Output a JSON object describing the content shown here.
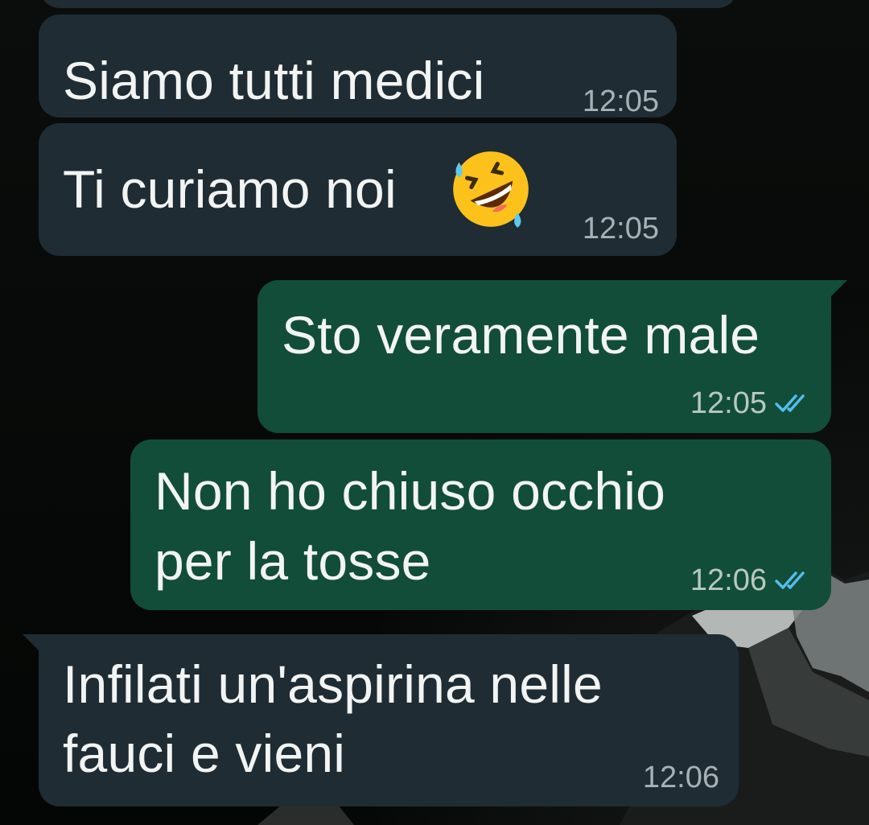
{
  "messages": [
    {
      "text": "Siamo tutti medici",
      "time": "12:05"
    },
    {
      "text": "Ti curiamo noi",
      "emoji_name": "rolling-on-the-floor-laughing-emoji",
      "time": "12:05"
    },
    {
      "text": "Sto veramente male",
      "time": "12:05",
      "status": "read"
    },
    {
      "text": [
        "Non ho chiuso occhio",
        "per la tosse"
      ],
      "time": "12:06",
      "status": "read"
    },
    {
      "text": [
        "Infilati un'aspirina nelle",
        "fauci e vieni"
      ],
      "time": "12:06"
    }
  ],
  "colors": {
    "incoming_bubble": "#1f2c33",
    "outgoing_bubble": "#124d39",
    "read_ticks": "#53bdeb",
    "text": "#f2f4f3",
    "timestamp": "#a7b1b6"
  }
}
